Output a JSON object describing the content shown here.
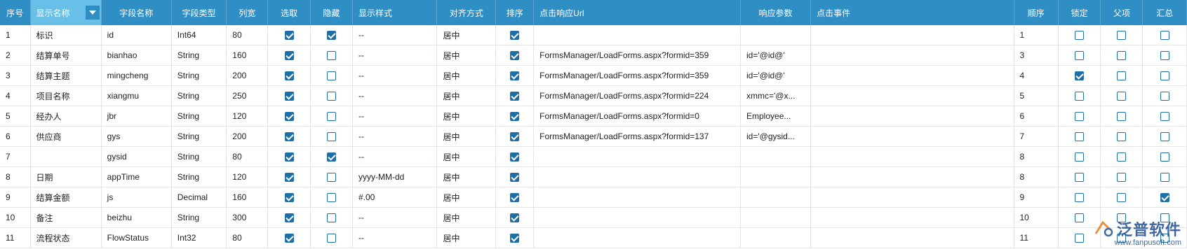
{
  "columns": [
    "序号",
    "显示名称",
    "字段名称",
    "字段类型",
    "列宽",
    "选取",
    "隐藏",
    "显示样式",
    "对齐方式",
    "排序",
    "点击响应Url",
    "响应参数",
    "点击事件",
    "顺序",
    "锁定",
    "父项",
    "汇总"
  ],
  "rows": [
    {
      "no": "1",
      "display": "标识",
      "field": "id",
      "type": "Int64",
      "width": "80",
      "pick": true,
      "hide": true,
      "style": "--",
      "align": "居中",
      "sort": true,
      "url": "",
      "param": "",
      "event": "",
      "order": "1",
      "lock": false,
      "parent": false,
      "sum": false
    },
    {
      "no": "2",
      "display": "结算单号",
      "field": "bianhao",
      "type": "String",
      "width": "160",
      "pick": true,
      "hide": false,
      "style": "--",
      "align": "居中",
      "sort": true,
      "url": "FormsManager/LoadForms.aspx?formid=359",
      "param": "id='@id@'",
      "event": "",
      "order": "3",
      "lock": false,
      "parent": false,
      "sum": false
    },
    {
      "no": "3",
      "display": "结算主题",
      "field": "mingcheng",
      "type": "String",
      "width": "200",
      "pick": true,
      "hide": false,
      "style": "--",
      "align": "居中",
      "sort": true,
      "url": "FormsManager/LoadForms.aspx?formid=359",
      "param": "id='@id@'",
      "event": "",
      "order": "4",
      "lock": true,
      "parent": false,
      "sum": false
    },
    {
      "no": "4",
      "display": "项目名称",
      "field": "xiangmu",
      "type": "String",
      "width": "250",
      "pick": true,
      "hide": false,
      "style": "--",
      "align": "居中",
      "sort": true,
      "url": "FormsManager/LoadForms.aspx?formid=224",
      "param": "xmmc='@x...",
      "event": "",
      "order": "5",
      "lock": false,
      "parent": false,
      "sum": false
    },
    {
      "no": "5",
      "display": "经办人",
      "field": "jbr",
      "type": "String",
      "width": "120",
      "pick": true,
      "hide": false,
      "style": "--",
      "align": "居中",
      "sort": true,
      "url": "FormsManager/LoadForms.aspx?formid=0",
      "param": "Employee...",
      "event": "",
      "order": "6",
      "lock": false,
      "parent": false,
      "sum": false
    },
    {
      "no": "6",
      "display": "供应商",
      "field": "gys",
      "type": "String",
      "width": "200",
      "pick": true,
      "hide": false,
      "style": "--",
      "align": "居中",
      "sort": true,
      "url": "FormsManager/LoadForms.aspx?formid=137",
      "param": "id='@gysid...",
      "event": "",
      "order": "7",
      "lock": false,
      "parent": false,
      "sum": false
    },
    {
      "no": "7",
      "display": "",
      "field": "gysid",
      "type": "String",
      "width": "80",
      "pick": true,
      "hide": true,
      "style": "--",
      "align": "居中",
      "sort": true,
      "url": "",
      "param": "",
      "event": "",
      "order": "8",
      "lock": false,
      "parent": false,
      "sum": false
    },
    {
      "no": "8",
      "display": "日期",
      "field": "appTime",
      "type": "String",
      "width": "120",
      "pick": true,
      "hide": false,
      "style": "yyyy-MM-dd",
      "align": "居中",
      "sort": true,
      "url": "",
      "param": "",
      "event": "",
      "order": "8",
      "lock": false,
      "parent": false,
      "sum": false
    },
    {
      "no": "9",
      "display": "结算金额",
      "field": "js",
      "type": "Decimal",
      "width": "160",
      "pick": true,
      "hide": false,
      "style": "#.00",
      "align": "居中",
      "sort": true,
      "url": "",
      "param": "",
      "event": "",
      "order": "9",
      "lock": false,
      "parent": false,
      "sum": true
    },
    {
      "no": "10",
      "display": "备注",
      "field": "beizhu",
      "type": "String",
      "width": "300",
      "pick": true,
      "hide": false,
      "style": "--",
      "align": "居中",
      "sort": true,
      "url": "",
      "param": "",
      "event": "",
      "order": "10",
      "lock": false,
      "parent": false,
      "sum": false
    },
    {
      "no": "11",
      "display": "流程状态",
      "field": "FlowStatus",
      "type": "Int32",
      "width": "80",
      "pick": true,
      "hide": false,
      "style": "--",
      "align": "居中",
      "sort": true,
      "url": "",
      "param": "",
      "event": "",
      "order": "11",
      "lock": false,
      "parent": false,
      "sum": false
    }
  ],
  "watermark": {
    "name": "泛普软件",
    "url": "www.fanpusoft.com"
  },
  "colors": {
    "header": "#2f8ec4",
    "header_selected": "#68bfe8",
    "checkbox": "#1d6fa5",
    "border": "#e2e6ea"
  }
}
